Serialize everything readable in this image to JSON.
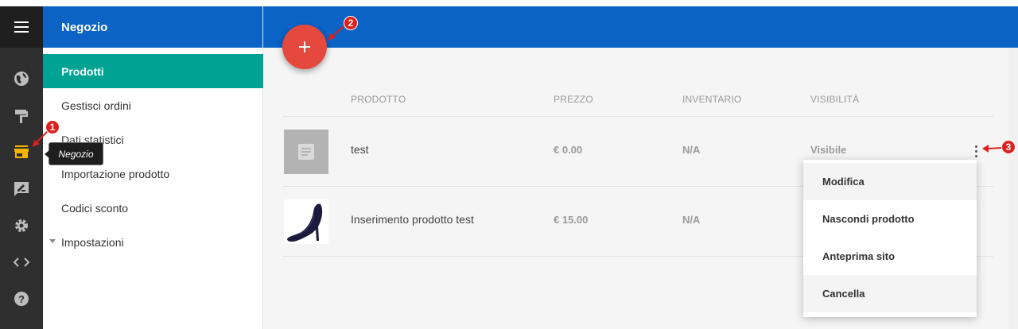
{
  "sidebar_header": "Negozio",
  "nav_items": [
    {
      "label": "Prodotti",
      "active": true
    },
    {
      "label": "Gestisci ordini"
    },
    {
      "label": "Dati statistici"
    },
    {
      "label": "Importazione prodotto"
    },
    {
      "label": "Codici sconto"
    },
    {
      "label": "Impostazioni",
      "expandable": true
    }
  ],
  "rail_icons": [
    "globe-icon",
    "paint-roller-icon",
    "store-icon",
    "edit-box-icon",
    "gear-icon",
    "code-icon",
    "help-icon"
  ],
  "tooltip": "Negozio",
  "fab_label": "+",
  "table": {
    "columns": [
      "PRODOTTO",
      "PREZZO",
      "INVENTARIO",
      "VISIBILITÀ"
    ],
    "rows": [
      {
        "name": "test",
        "price": "€ 0.00",
        "inventory": "N/A",
        "visibility": "Visibile",
        "thumb": "placeholder-document"
      },
      {
        "name": "Inserimento prodotto test",
        "price": "€ 15.00",
        "inventory": "N/A",
        "visibility": "",
        "thumb": "high-heel-shoe"
      }
    ]
  },
  "context_menu": [
    "Modifica",
    "Nascondi prodotto",
    "Anteprima sito",
    "Cancella"
  ],
  "annotations": [
    "1",
    "2",
    "3"
  ],
  "colors": {
    "header_blue": "#0b63c5",
    "active_teal": "#00a294",
    "fab_red": "#e5483c",
    "rail_dark": "#2f2f2f",
    "store_icon_yellow": "#f5b400",
    "annotation_red": "#e0201e"
  }
}
